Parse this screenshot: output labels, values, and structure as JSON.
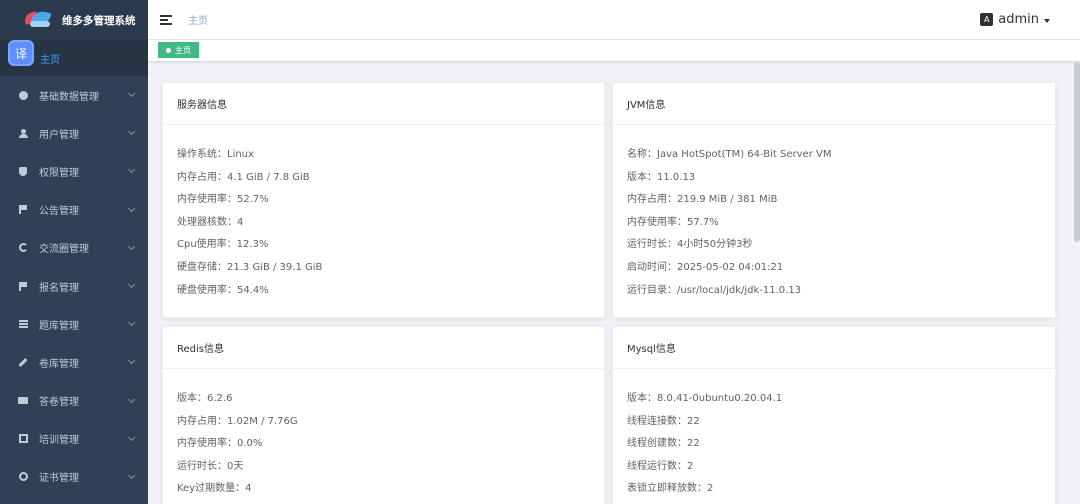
{
  "app": {
    "title": "维多多管理系统"
  },
  "translate_badge": "译",
  "sidebar": {
    "home_label": "主页",
    "items": [
      {
        "label": "基础数据管理",
        "icon": "gear-icon"
      },
      {
        "label": "用户管理",
        "icon": "user-icon"
      },
      {
        "label": "权限管理",
        "icon": "shield-icon"
      },
      {
        "label": "公告管理",
        "icon": "megaphone-icon"
      },
      {
        "label": "交流圈管理",
        "icon": "circle-icon"
      },
      {
        "label": "报名管理",
        "icon": "flag-icon"
      },
      {
        "label": "题库管理",
        "icon": "list-icon"
      },
      {
        "label": "卷库管理",
        "icon": "pen-icon"
      },
      {
        "label": "答卷管理",
        "icon": "book-icon"
      },
      {
        "label": "培训管理",
        "icon": "board-icon"
      },
      {
        "label": "证书管理",
        "icon": "certificate-icon"
      }
    ]
  },
  "navbar": {
    "breadcrumb": "主页",
    "lang_icon": "A",
    "user": "admin"
  },
  "tags": {
    "active": "主页"
  },
  "server": {
    "title": "服务器信息",
    "rows": [
      "操作系统：Linux",
      "内存占用：4.1 GiB / 7.8 GiB",
      "内存使用率：52.7%",
      "处理器核数：4",
      "Cpu使用率：12.3%",
      "硬盘存储：21.3 GiB / 39.1 GiB",
      "硬盘使用率：54.4%"
    ]
  },
  "jvm": {
    "title": "JVM信息",
    "rows": [
      "名称：Java HotSpot(TM) 64-Bit Server VM",
      "版本：11.0.13",
      "内存占用：219.9 MiB / 381 MiB",
      "内存使用率：57.7%",
      "运行时长：4小时50分钟3秒",
      "启动时间：2025-05-02 04:01:21",
      "运行目录：/usr/local/jdk/jdk-11.0.13"
    ]
  },
  "redis": {
    "title": "Redis信息",
    "rows": [
      "版本：6.2.6",
      "内存占用：1.02M / 7.76G",
      "内存使用率：0.0%",
      "运行时长：0天",
      "Key过期数量：4"
    ]
  },
  "mysql": {
    "title": "Mysql信息",
    "rows": [
      "版本：8.0.41-0ubuntu0.20.04.1",
      "线程连接数：22",
      "线程创建数：22",
      "线程运行数：2",
      "表锁立即释放数：2"
    ]
  }
}
